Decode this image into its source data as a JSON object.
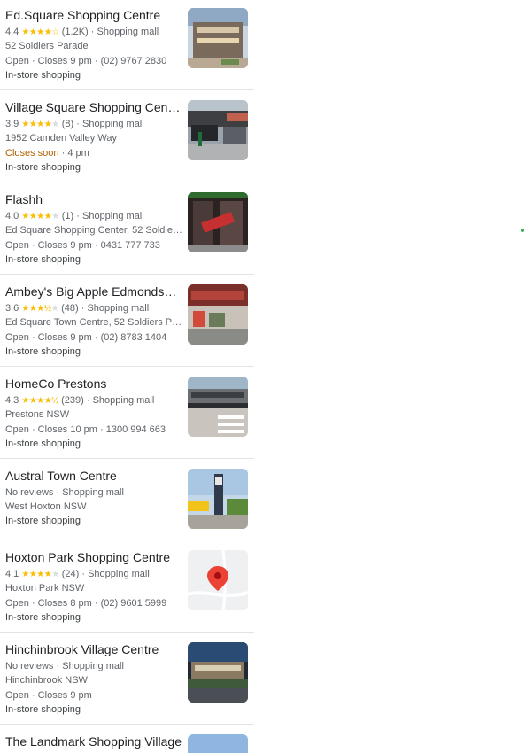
{
  "results": [
    {
      "name": "Ed.Square Shopping Centre",
      "rating": "4.4",
      "stars": "★★★★",
      "stars_empty": "☆",
      "reviews": "(1.2K)",
      "category": "Shopping mall",
      "address": "52 Soldiers Parade",
      "status_prefix": "Open",
      "status": "Open · Closes 9 pm · (02) 9767 2830",
      "status_warning": "",
      "service": "In-store shopping"
    },
    {
      "name": "Village Square Shopping Centre...",
      "rating": "3.9",
      "stars": "★★★★",
      "stars_empty": "★",
      "reviews": "(8)",
      "category": "Shopping mall",
      "address": "1952 Camden Valley Way",
      "status": " · 4 pm",
      "status_warning": "Closes soon",
      "service": "In-store shopping"
    },
    {
      "name": "Flashh",
      "rating": "4.0",
      "stars": "★★★★",
      "stars_empty": "★",
      "reviews": "(1)",
      "category": "Shopping mall",
      "address": "Ed Square Shopping Center, 52 Soldiers...",
      "status": "Open · Closes 9 pm · 0431 777 733",
      "status_warning": "",
      "service": "In-store shopping"
    },
    {
      "name": "Ambey's Big Apple Edmondson...",
      "rating": "3.6",
      "stars": "★★★½",
      "stars_empty": "★",
      "reviews": "(48)",
      "category": "Shopping mall",
      "address": "Ed Square Town Centre, 52 Soldiers Par...",
      "status": "Open · Closes 9 pm · (02) 8783 1404",
      "status_warning": "",
      "service": "In-store shopping"
    },
    {
      "name": "HomeCo Prestons",
      "rating": "4.3",
      "stars": "★★★★½",
      "stars_empty": "",
      "reviews": "(239)",
      "category": "Shopping mall",
      "address": "Prestons NSW",
      "status": "Open · Closes 10 pm · 1300 994 663",
      "status_warning": "",
      "service": "In-store shopping"
    },
    {
      "name": "Austral Town Centre",
      "rating": "",
      "stars": "",
      "stars_empty": "",
      "reviews": "No reviews",
      "category": "Shopping mall",
      "address": "West Hoxton NSW",
      "status": "",
      "status_warning": "",
      "service": "In-store shopping"
    },
    {
      "name": "Hoxton Park Shopping Centre",
      "rating": "4.1",
      "stars": "★★★★",
      "stars_empty": "★",
      "reviews": "(24)",
      "category": "Shopping mall",
      "address": "Hoxton Park NSW",
      "status": "Open · Closes 8 pm · (02) 9601 5999",
      "status_warning": "",
      "service": "In-store shopping"
    },
    {
      "name": "Hinchinbrook Village Centre",
      "rating": "",
      "stars": "",
      "stars_empty": "",
      "reviews": "No reviews",
      "category": "Shopping mall",
      "address": "Hinchinbrook NSW",
      "status": "Open · Closes 9 pm",
      "status_warning": "",
      "service": "In-store shopping"
    },
    {
      "name": "The Landmark Shopping Village",
      "rating": "",
      "stars": "",
      "stars_empty": "",
      "reviews": "",
      "category": "",
      "address": "",
      "status": "",
      "status_warning": "",
      "service": ""
    }
  ],
  "colors": {
    "star": "#fbbc04",
    "warning": "#b06000",
    "text_secondary": "#5f6368"
  }
}
